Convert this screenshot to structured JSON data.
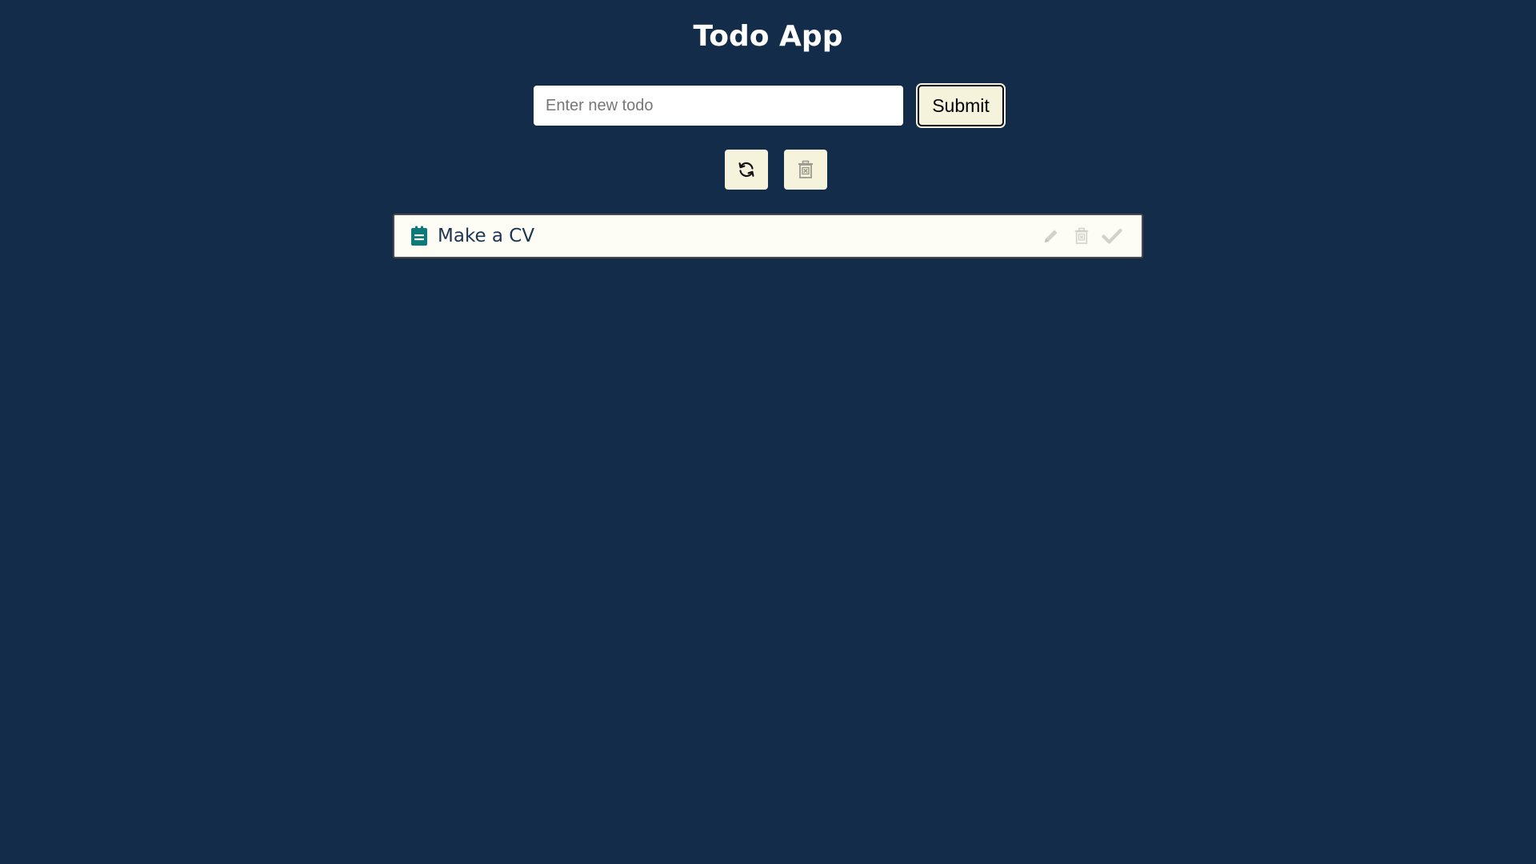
{
  "header": {
    "title": "Todo App"
  },
  "form": {
    "input_placeholder": "Enter new todo",
    "input_value": "",
    "submit_label": "Submit"
  },
  "toolbar": {
    "refresh_icon": "refresh-icon",
    "clear_all_icon": "trash-x-icon"
  },
  "todos": [
    {
      "text": "Make a CV",
      "icon": "clipboard-icon",
      "actions": [
        "pencil-icon",
        "trash-x-icon",
        "check-icon"
      ]
    }
  ],
  "colors": {
    "background": "#122c4a",
    "button_bg": "#f6f3dc",
    "item_bg": "#fdfdf6",
    "item_icon": "#0b7a78",
    "action_icons": "#cfcfcf"
  }
}
